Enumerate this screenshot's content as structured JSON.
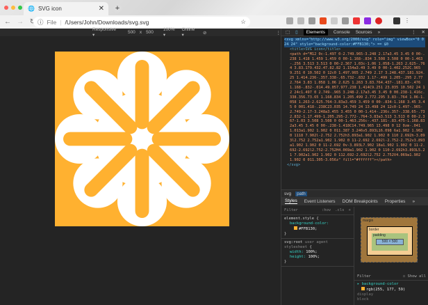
{
  "browser": {
    "tab_title": "SVG icon",
    "close": "✕",
    "new_tab": "+",
    "url_scheme": "File",
    "url": "/Users/John/Downloads/svg.svg",
    "traffic_colors": [
      "#fc605b",
      "#fdbc40",
      "#34c84a"
    ]
  },
  "device_toolbar": {
    "device": "Responsive ▾",
    "width": "500",
    "x": "x",
    "height": "500",
    "zoom": "100% ▾",
    "network": "Online ▾"
  },
  "page": {
    "background": "#FFB130",
    "icon_color": "#ffffff"
  },
  "devtools": {
    "tabs": [
      "Elements",
      "Console",
      "Sources",
      "»"
    ],
    "code": {
      "svg_open": "<svg xmlns=\"http://www.w3.org/2000/svg\" role=\"img\" viewBox=\"0 0 24 24\" style=\"background-color:#FFB130;\"> == $0",
      "title": "<title>SVG icon</title>",
      "path": "<path d=\"M12 0c-1.497 0-2.749.965-3.248 2.17a3.45 3.45 0 00-.238 1.418 1.459 1.459 0 00-1.168-.834 3.508 3.508 0 00-1.463-.256 3.513 3.513 0 00-2.367 1.03c-1.06 1.058-1.263 2.625-.764 3.83.179.432.47.82.82 1.154a3.49 3.49 0 00-1.402.252C.965 9.251 0 10.502 0 12c0 1.497.965 2.749 2.17 3.248.437.181.924.25 1.414.236-.357.338-.65.732-.832 1.17-.499 1.205-.295 2.772.764 3.83 1.058 1.06 2.625 1.263 3.83.764.437-.181.83-.476 1.168-.832-.014.49.057.977.238 1.414C9.251 23.035 10.502 24 12 24c1.497 0 2.749-.965 3.248-2.17a3.45 3.45 0 00.238-1.416c.338.356.73.65 1.168.834 1.205.499 2.772.295 3.83-.764 1.06-1.058 1.263-2.625.764-3.83a3.459 3.459 0 00-.834-1.168 3.45 3.45 0 001.418-.238C23.035 14.749 24 13.498 24 12c0-1.497-.965-2.749-2.17-3.248a3.455 3.455 0 00-1.414-.236c.357-.338.65-.732.832-1.17.499-1.205.295-2.772-.764-3.83a3.513 3.513 0 00-2.367-1.03 3.508 3.508 0 00-1.463.256c-.437.181-.83.475-1.168.832a3.45 3.45 0 00-.238-1.418C14.749.965 13.498 0 12 0zm-.041 1.013a1.902 1.902 0 011.387 3.246v5.893L16.098 6a1.902 1.902 0 1118 7.902l-2.752 2.752h3.893a1.902 1.902 0 110 2.692h-3.893l2.752 2.752a1.902 1.902 0 11-2.692 2.692l-2.752-2.752v3.893a1.902 1.902 0 11-2.692 0v-3.893L7.902 18a1.902 1.902 0 11-2.692-2.692l2.752-2.752H4.069a1.902 1.902 0 110-2.692h3.893L5.21 7.902a1.902 1.902 0 112.692-2.692l2.752 2.752V4.069a1.902 1.902 0 011.305-3.056z\" fill=\"#ffffff\"></path>",
      "svg_close": "</svg>"
    },
    "breadcrumb": [
      "svg",
      "path"
    ],
    "subtabs": [
      "Styles",
      "Event Listeners",
      "DOM Breakpoints",
      "Properties",
      "»"
    ],
    "filter_placeholder": "Filter",
    "hov": ":hov",
    "cls": ".cls",
    "plus": "+",
    "element_style": {
      "selector": "element.style {",
      "prop": "background-color:",
      "value": "#FFB130;",
      "close": "}"
    },
    "ua_rule": {
      "selector": "svg:root",
      "source": "user agent stylesheet",
      "open": "{",
      "props": [
        {
          "p": "width:",
          "v": "100%;"
        },
        {
          "p": "height:",
          "v": "100%;"
        }
      ],
      "close": "}"
    },
    "box_model": {
      "margin": "margin",
      "border": "border",
      "padding": "padding",
      "content": "500 × 500",
      "dash": "-"
    },
    "computed": {
      "filter": "Filter",
      "show_all": "Show all",
      "prop": "background-color",
      "value": "rgb(255, 177, 59)",
      "extra1": "display",
      "extra2": "block"
    }
  }
}
